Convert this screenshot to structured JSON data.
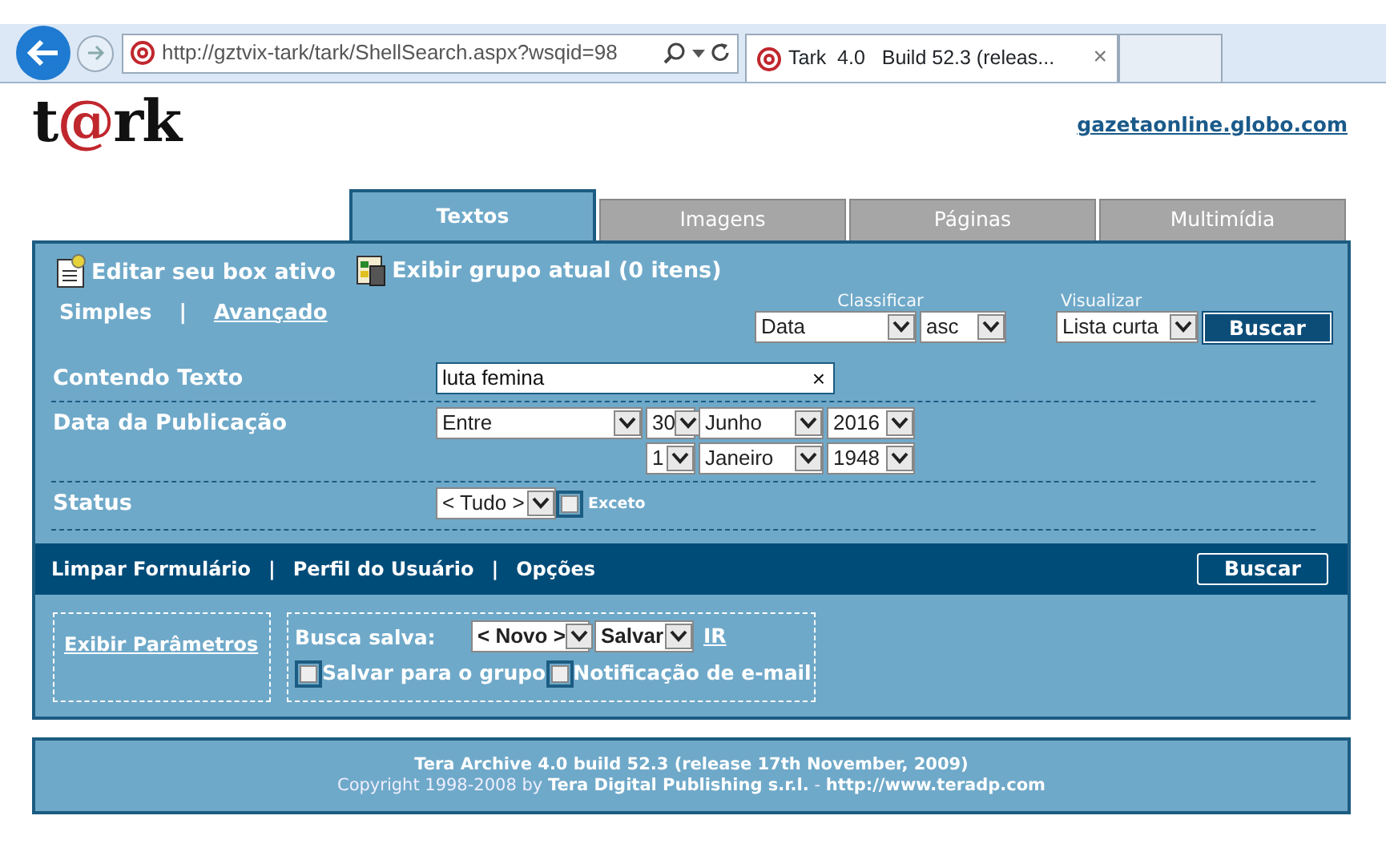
{
  "browser": {
    "address": "http://gztvix-tark/tark/ShellSearch.aspx?wsqid=98",
    "tab_title": "Tark  4.0   Build 52.3 (releas...",
    "tab_close": "×"
  },
  "header": {
    "logo": [
      {
        "text": "t",
        "color": "#111111"
      },
      {
        "text": "@",
        "color": "#c0272d"
      },
      {
        "text": "rk",
        "color": "#111111"
      }
    ],
    "site_link": "gazetaonline.globo.com"
  },
  "tabs": [
    {
      "label": "Textos",
      "selected": true
    },
    {
      "label": "Imagens",
      "selected": false
    },
    {
      "label": "Páginas",
      "selected": false
    },
    {
      "label": "Multimídia",
      "selected": false
    }
  ],
  "actions": [
    {
      "kind": "edit",
      "label": "Editar seu box ativo"
    },
    {
      "kind": "group",
      "label": "Exibir grupo atual (0 itens)"
    }
  ],
  "modes": [
    {
      "label": "Simples",
      "selected": true
    },
    {
      "label": "Avançado",
      "selected": false
    }
  ],
  "mode_separator": "|",
  "sort": {
    "label": "Classificar",
    "field": "Data",
    "order": "asc"
  },
  "view": {
    "label": "Visualizar",
    "value": "Lista curta"
  },
  "search_button": "Buscar",
  "fields": [
    {
      "kind": "text",
      "label": "Contendo Texto",
      "value": "luta femina",
      "clear": "×"
    },
    {
      "kind": "date_range",
      "label": "Data da Publicação",
      "mode": "Entre",
      "from": [
        "30",
        "Junho",
        "2016"
      ],
      "to": [
        "1",
        "Janeiro",
        "1948"
      ]
    },
    {
      "kind": "status",
      "label": "Status",
      "value": "< Tudo >",
      "exclude": {
        "label": "Exceto",
        "checked": false
      }
    }
  ],
  "links_bar": {
    "links": [
      "Limpar Formulário",
      "Perfil do Usuário",
      "Opções"
    ],
    "separator": "|",
    "button": "Buscar"
  },
  "params_link": "Exibir Parâmetros",
  "saved_search": {
    "label": "Busca salva:",
    "select": "< Novo >",
    "action": "Salvar",
    "go": "IR",
    "options": [
      {
        "label": "Salvar para o grupo",
        "checked": false
      },
      {
        "label": "Notificação de e-mail",
        "checked": false
      }
    ]
  },
  "footer": {
    "line1": "Tera Archive 4.0 build 52.3 (release 17th November, 2009)",
    "line2": "Copyright 1998-2008 by **Tera Digital Publishing s.r.l.** - **http://www.teradp.com**"
  }
}
